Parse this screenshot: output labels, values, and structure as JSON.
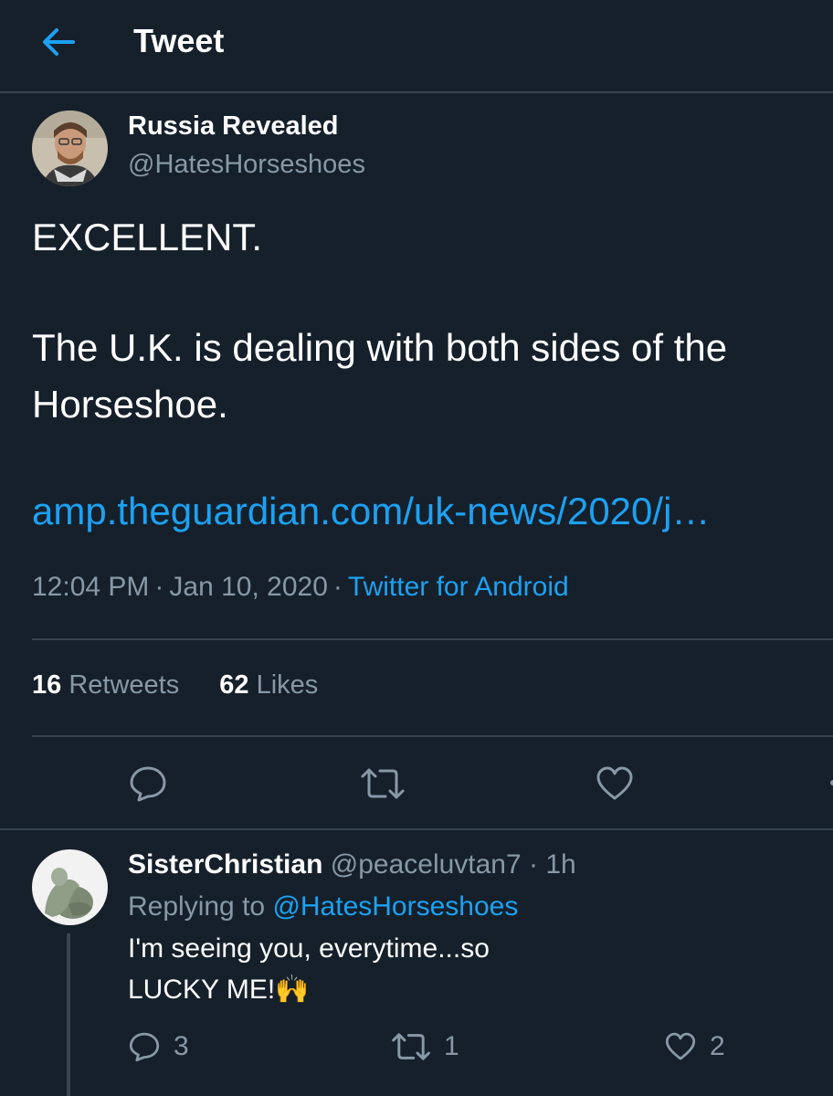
{
  "header": {
    "title": "Tweet",
    "back_icon": "arrow-left-icon"
  },
  "tweet": {
    "author_name": "Russia Revealed",
    "author_handle": "@HatesHorseshoes",
    "text_line1": "EXCELLENT.",
    "text_line2": "The U.K. is dealing with both sides of the",
    "text_line3": "Horseshoe.",
    "link": "amp.theguardian.com/uk-news/2020/j…",
    "time": "12:04 PM",
    "date": "Jan 10, 2020",
    "source": "Twitter for Android",
    "retweets_count": "16",
    "retweets_label": "Retweets",
    "likes_count": "62",
    "likes_label": "Likes"
  },
  "reply": {
    "author_name": "SisterChristian",
    "author_handle": "@peaceluvtan7",
    "age": "1h",
    "replying_label": "Replying to",
    "replying_to": "@HatesHorseshoes",
    "text_line1": "I'm seeing you, everytime...so",
    "text_line2": "LUCKY ME!🙌",
    "reply_count": "3",
    "retweet_count": "1",
    "like_count": "2"
  },
  "colors": {
    "background": "#15202b",
    "accent": "#1da1f2",
    "muted": "#8899a6",
    "divider": "#38444d"
  }
}
